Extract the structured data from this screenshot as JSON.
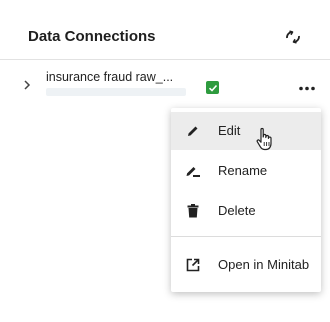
{
  "panel": {
    "title": "Data Connections",
    "refresh_icon": "refresh-icon"
  },
  "connection": {
    "name": "insurance fraud raw_...",
    "status": "connected",
    "status_color": "#2e9b3e"
  },
  "context_menu": {
    "items": [
      {
        "label": "Edit",
        "icon": "pencil-icon"
      },
      {
        "label": "Rename",
        "icon": "rename-icon"
      },
      {
        "label": "Delete",
        "icon": "trash-icon"
      },
      {
        "label": "Open in Minitab",
        "icon": "open-external-icon"
      }
    ]
  }
}
